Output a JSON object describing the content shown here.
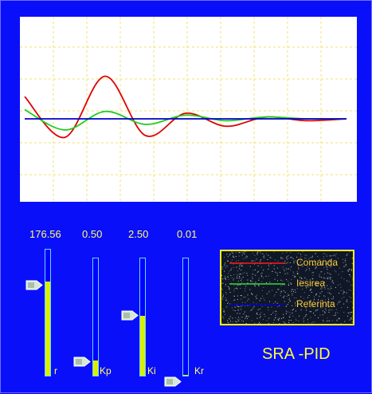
{
  "app": {
    "title": "SRA -PID"
  },
  "sliders": [
    {
      "key": "r",
      "label": "r",
      "value_text": "176.56",
      "level": 0.75
    },
    {
      "key": "kp",
      "label": "Kp",
      "value_text": "0.50",
      "level": 0.13
    },
    {
      "key": "ki",
      "label": "Ki",
      "value_text": "2.50",
      "level": 0.51
    },
    {
      "key": "kr",
      "label": "Kr",
      "value_text": "0.01",
      "level": 0.01
    }
  ],
  "legend": {
    "items": [
      {
        "label": "Comanda",
        "color": "#ff1a1a"
      },
      {
        "label": "Iesirea",
        "color": "#33dd33"
      },
      {
        "label": "Referinta",
        "color": "#0000cc"
      }
    ]
  },
  "chart_data": {
    "type": "line",
    "title": "",
    "xlabel": "",
    "ylabel": "",
    "grid": true,
    "series": [
      {
        "name": "Comanda",
        "color": "#e00000",
        "values": [
          0.62,
          0.4,
          0.73,
          0.41,
          0.53,
          0.46,
          0.51,
          0.49,
          0.5
        ]
      },
      {
        "name": "Iesirea",
        "color": "#22cc22",
        "values": [
          0.55,
          0.44,
          0.54,
          0.47,
          0.52,
          0.49,
          0.51,
          0.5,
          0.5
        ]
      },
      {
        "name": "Referinta",
        "color": "#0000cc",
        "values": [
          0.5,
          0.5,
          0.5,
          0.5,
          0.5,
          0.5,
          0.5,
          0.5,
          0.5
        ]
      }
    ]
  }
}
